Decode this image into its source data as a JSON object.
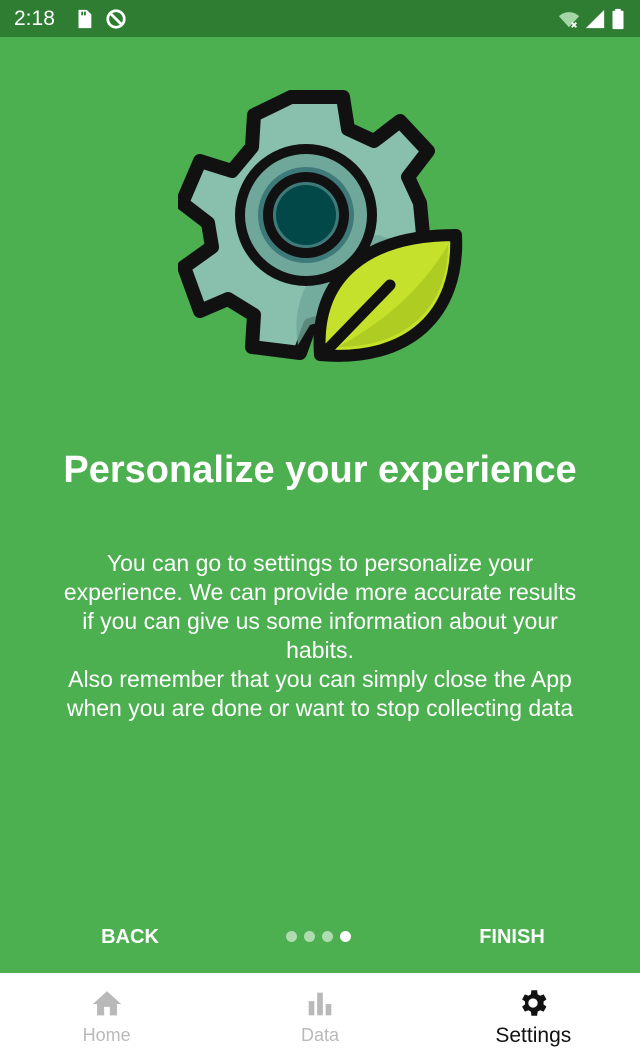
{
  "status_bar": {
    "time": "2:18",
    "left_icons": [
      "sd-card-icon",
      "do-not-disturb-icon"
    ],
    "right_icons": [
      "wifi-icon",
      "signal-icon",
      "battery-icon"
    ]
  },
  "onboarding": {
    "hero_icon": "gear-leaf-icon",
    "title": "Personalize your experience",
    "description_line1": "You can go to settings to personalize your experience. We can provide more accurate results if you can give us some information about your habits.",
    "description_line2": "Also remember that you can simply close the App when you are done or want to stop collecting data",
    "back_label": "BACK",
    "finish_label": "FINISH",
    "pages_total": 4,
    "current_page": 4
  },
  "bottom_nav": {
    "items": [
      {
        "label": "Home",
        "icon": "home-icon",
        "active": false
      },
      {
        "label": "Data",
        "icon": "bar-chart-icon",
        "active": false
      },
      {
        "label": "Settings",
        "icon": "gear-icon",
        "active": true
      }
    ]
  },
  "colors": {
    "primary": "#4caf50",
    "status_bar": "#2e7d32",
    "nav_inactive": "#b9b9b9",
    "nav_active": "#111111"
  }
}
